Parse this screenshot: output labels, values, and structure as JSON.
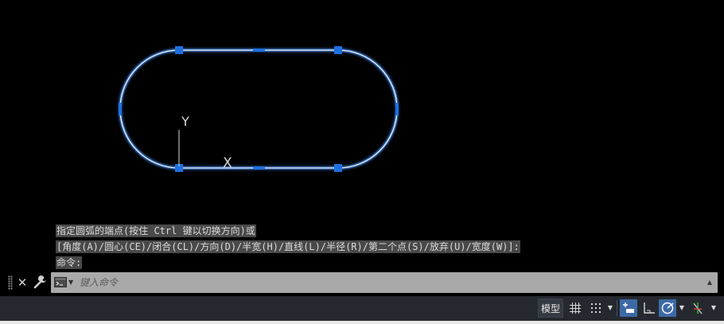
{
  "canvas": {
    "colors": {
      "background": "#000000",
      "shape_stroke": "#ffffff",
      "shape_glow": "#3a7bd5",
      "grip": "#1f6fe0",
      "ucs": "#d8d8d8"
    },
    "ucs_icon": {
      "x_label": "X",
      "y_label": "Y"
    }
  },
  "command_history": [
    "指定圆弧的端点(按住 Ctrl 键以切换方向)或",
    "[角度(A)/圆心(CE)/闭合(CL)/方向(D)/半宽(H)/直线(L)/半径(R)/第二个点(S)/放弃(U)/宽度(W)]:",
    "命令:"
  ],
  "command_line": {
    "placeholder": "键入命令",
    "value": "",
    "icons": {
      "grip": "grip-icon",
      "close": "close-icon",
      "customize": "wrench-icon",
      "prompt": "command-prompt-icon",
      "recent": "caret-up-icon"
    },
    "close_glyph": "✕",
    "recent_glyph": "▲",
    "prompt_caret_glyph": "▼"
  },
  "status_bar": {
    "model_label": "模型",
    "dropdown_glyph": "▼",
    "icons": [
      "grid-icon",
      "snap-mode-icon",
      "infer-constraints-icon",
      "ortho-mode-icon",
      "polar-tracking-icon",
      "isometric-drafting-icon"
    ],
    "active_color": "#3d6aa6",
    "background": "#25292f"
  }
}
